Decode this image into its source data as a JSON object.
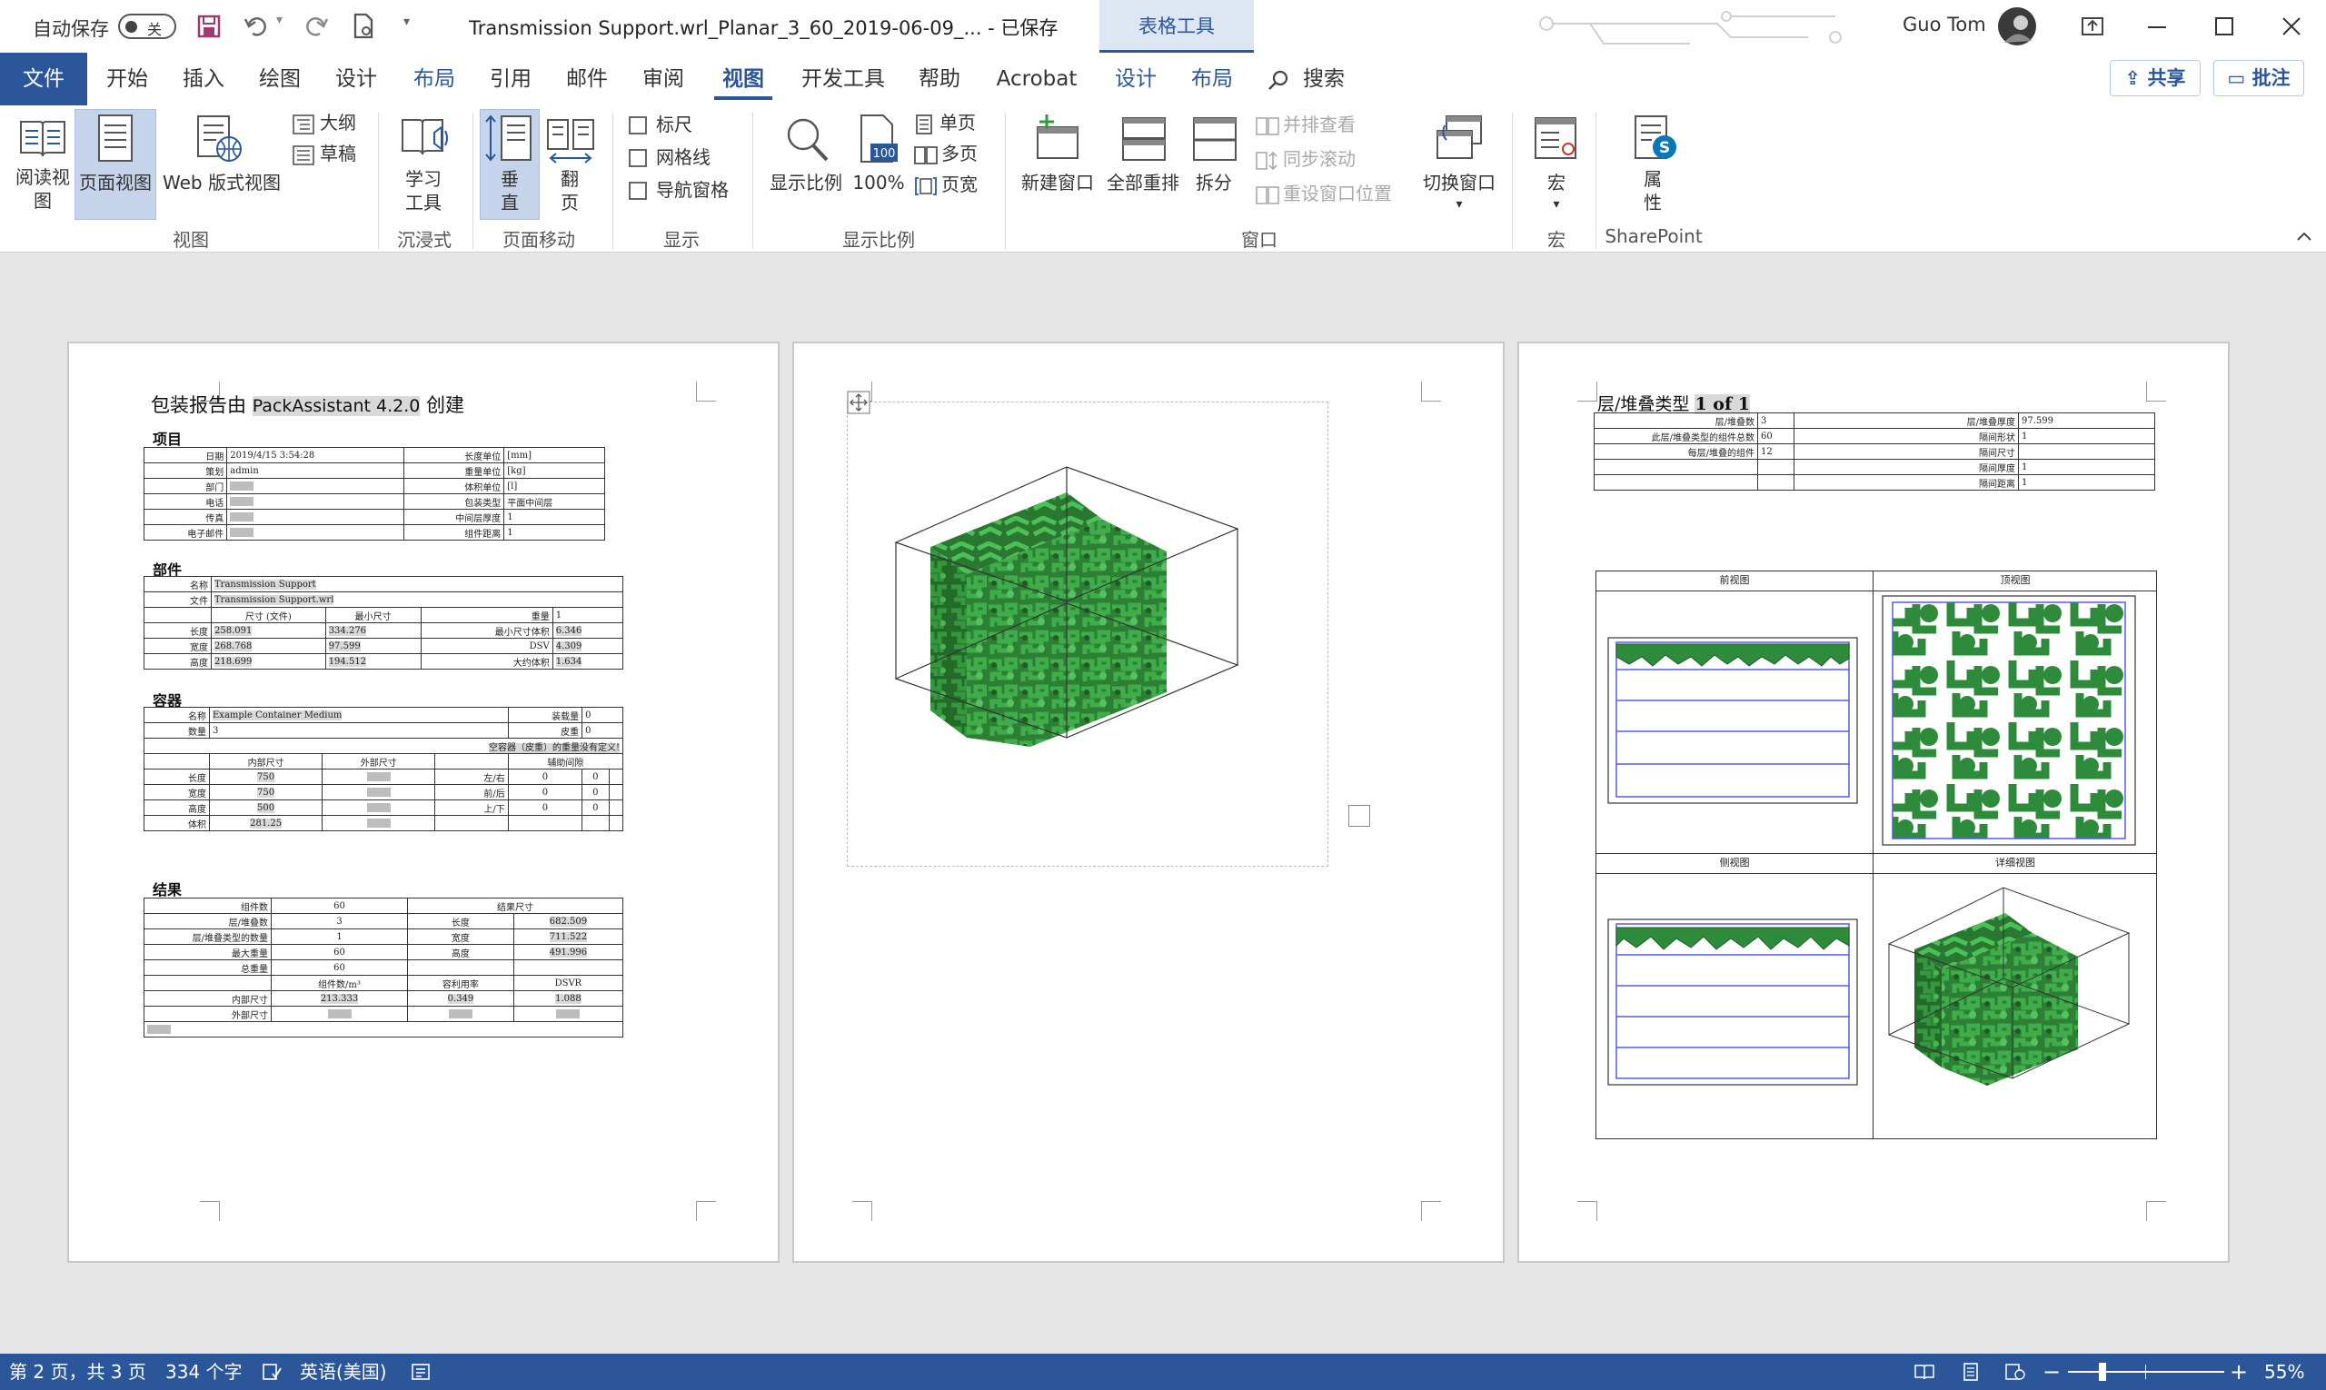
{
  "titlebar": {
    "autosave_label": "自动保存",
    "autosave_state": "关",
    "doc_title": "Transmission Support.wrl_Planar_3_60_2019-06-09_...  -  已保存",
    "context_tab": "表格工具",
    "user_name": "Guo Tom"
  },
  "tabs": {
    "file": "文件",
    "items": [
      "开始",
      "插入",
      "绘图",
      "设计",
      "布局",
      "引用",
      "邮件",
      "审阅",
      "视图",
      "开发工具",
      "帮助",
      "Acrobat",
      "设计",
      "布局"
    ],
    "search": "搜索",
    "share": "共享",
    "comments": "批注"
  },
  "ribbon": {
    "views": {
      "read": "阅读视图",
      "print": "页面视图",
      "web": "Web 版式视图",
      "outline": "大纲",
      "draft": "草稿",
      "group": "视图"
    },
    "immersive": {
      "learn": "学习工具",
      "group": "沉浸式"
    },
    "pagemove": {
      "vertical": "垂直",
      "side": "翻页",
      "group": "页面移动"
    },
    "show": {
      "ruler": "标尺",
      "gridlines": "网格线",
      "nav": "导航窗格",
      "group": "显示"
    },
    "zoom": {
      "zoom": "显示比例",
      "hundred": "100%",
      "one": "单页",
      "multi": "多页",
      "width": "页宽",
      "group": "显示比例"
    },
    "window": {
      "new": "新建窗口",
      "arrange": "全部重排",
      "split": "拆分",
      "side": "并排查看",
      "sync": "同步滚动",
      "reset": "重设窗口位置",
      "switch": "切换窗口",
      "group": "窗口"
    },
    "macros": {
      "label": "宏",
      "group": "宏"
    },
    "sharepoint": {
      "label": "属性",
      "group": "SharePoint"
    }
  },
  "page1": {
    "title_pre": "包装报告由 ",
    "title_brand": "PackAssistant 4.2.0",
    "title_post": " 创建",
    "sec_project": "项目",
    "sec_part": "部件",
    "sec_container": "容器",
    "sec_result": "结果",
    "project": {
      "rows": [
        [
          "日期",
          "2019/4/15 3:54:28",
          "长度单位",
          "[mm]"
        ],
        [
          "策划",
          "admin",
          "重量单位",
          "[kg]"
        ],
        [
          "部门",
          "",
          "体积单位",
          "[l]"
        ],
        [
          "电话",
          "",
          "包装类型",
          "平面中间层"
        ],
        [
          "传真",
          "",
          "中间层厚度",
          "1"
        ],
        [
          "电子邮件",
          "",
          "组件距离",
          "1"
        ]
      ]
    },
    "part": {
      "name_label": "名称",
      "name": "Transmission Support",
      "file_label": "文件",
      "file": "Transmission Support.wrl",
      "hdr": [
        "尺寸 (文件)",
        "最小尺寸",
        "重量",
        "1"
      ],
      "rows": [
        [
          "长度",
          "258.091",
          "334.276",
          "最小尺寸体积",
          "6.346"
        ],
        [
          "宽度",
          "268.768",
          "97.599",
          "DSV",
          "4.309"
        ],
        [
          "高度",
          "218.699",
          "194.512",
          "大约体积",
          "1.634"
        ]
      ]
    },
    "container": {
      "name_label": "名称",
      "name": "Example Container Medium",
      "load_label": "装载量",
      "load": "0",
      "count_label": "数量",
      "count": "3",
      "tare_label": "皮重",
      "tare": "0",
      "note": "空容器（皮重）的重量没有定义!",
      "inner": "内部尺寸",
      "outer": "外部尺寸",
      "aux": "辅助间隙",
      "rows": [
        [
          "长度",
          "750",
          "左/右",
          "0",
          "0"
        ],
        [
          "宽度",
          "750",
          "前/后",
          "0",
          "0"
        ],
        [
          "高度",
          "500",
          "上/下",
          "0",
          "0"
        ],
        [
          "体积",
          "281.25",
          "",
          "",
          ""
        ]
      ]
    },
    "result": {
      "count_label": "组件数",
      "count": "60",
      "size_label": "结果尺寸",
      "rows": [
        [
          "层/堆叠数",
          "3",
          "长度",
          "682.509"
        ],
        [
          "层/堆叠类型的数量",
          "1",
          "宽度",
          "711.522"
        ],
        [
          "最大重量",
          "60",
          "高度",
          "491.996"
        ],
        [
          "总重量",
          "60",
          "",
          ""
        ]
      ],
      "hdr2": [
        "组件数/m³",
        "容利用率",
        "DSVR"
      ],
      "inner_label": "内部尺寸",
      "inner": [
        "213.333",
        "0.349",
        "1.088"
      ],
      "outer_label": "外部尺寸"
    }
  },
  "page3": {
    "title_pre": "层/堆叠类型 ",
    "title_val": "1 of 1",
    "rows": [
      [
        "层/堆叠数",
        "3",
        "层/堆叠厚度",
        "97.599"
      ],
      [
        "此层/堆叠类型的组件总数",
        "60",
        "隔间形状",
        "1"
      ],
      [
        "每层/堆叠的组件",
        "12",
        "隔间尺寸",
        ""
      ],
      [
        "",
        "",
        "隔间厚度",
        "1"
      ],
      [
        "",
        "",
        "隔间距离",
        "1"
      ]
    ],
    "views": [
      "前视图",
      "顶视图",
      "侧视图",
      "详细视图"
    ]
  },
  "statusbar": {
    "page": "第 2 页，共 3 页",
    "words": "334 个字",
    "lang": "英语(美国)",
    "zoom": "55%"
  },
  "colors": {
    "accent": "#2b579a",
    "part_green": "#2e8b3c"
  }
}
